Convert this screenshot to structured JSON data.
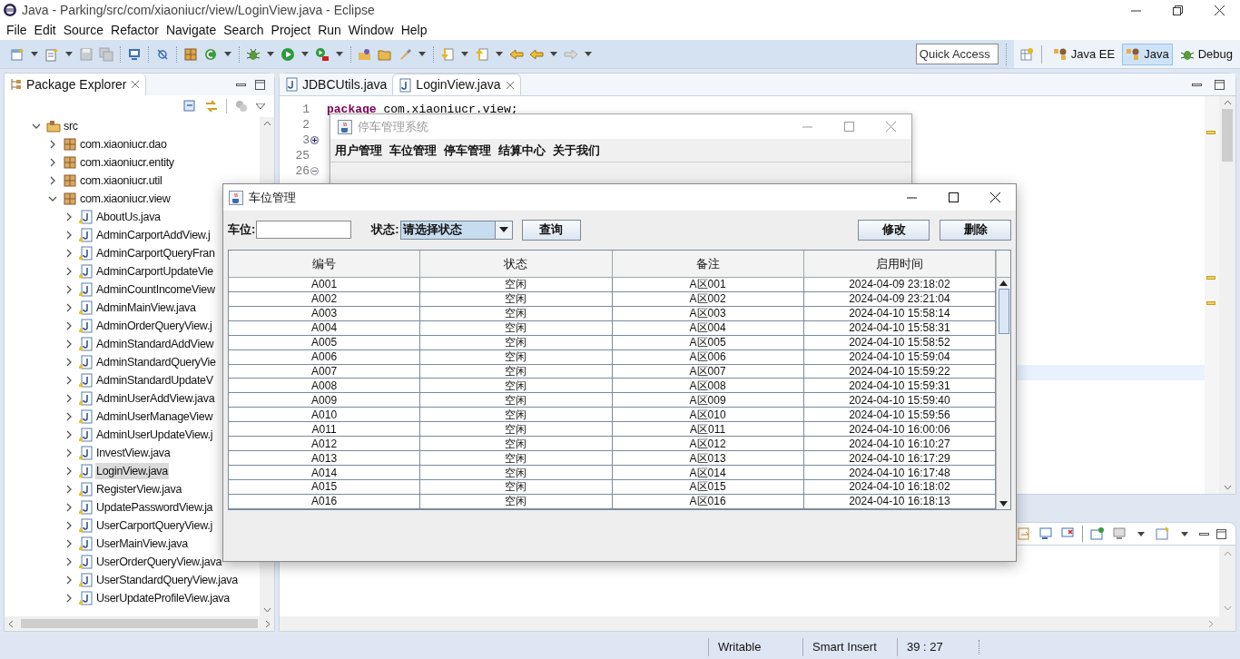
{
  "window": {
    "title": "Java - Parking/src/com/xiaoniucr/view/LoginView.java - Eclipse"
  },
  "menu": [
    "File",
    "Edit",
    "Source",
    "Refactor",
    "Navigate",
    "Search",
    "Project",
    "Run",
    "Window",
    "Help"
  ],
  "toolbar": {
    "quick_access": {
      "placeholder": "Quick Access"
    },
    "perspectives": [
      {
        "label": "Java EE",
        "selected": false
      },
      {
        "label": "Java",
        "selected": true
      },
      {
        "label": "Debug",
        "selected": false
      }
    ]
  },
  "package_explorer": {
    "title": "Package Explorer",
    "tree": [
      {
        "label": "src",
        "kind": "source-folder",
        "expanded": true,
        "selected": false,
        "children": [
          {
            "label": "com.xiaoniucr.dao",
            "kind": "package",
            "expanded": false,
            "selected": false
          },
          {
            "label": "com.xiaoniucr.entity",
            "kind": "package",
            "expanded": false,
            "selected": false
          },
          {
            "label": "com.xiaoniucr.util",
            "kind": "package",
            "expanded": false,
            "selected": false
          },
          {
            "label": "com.xiaoniucr.view",
            "kind": "package",
            "expanded": true,
            "selected": false,
            "children": [
              {
                "label": "AboutUs.java",
                "kind": "file",
                "expanded": false,
                "selected": false
              },
              {
                "label": "AdminCarportAddView.j",
                "kind": "file",
                "expanded": false,
                "selected": false
              },
              {
                "label": "AdminCarportQueryFran",
                "kind": "file",
                "expanded": false,
                "selected": false
              },
              {
                "label": "AdminCarportUpdateVie",
                "kind": "file",
                "expanded": false,
                "selected": false
              },
              {
                "label": "AdminCountIncomeView",
                "kind": "file",
                "expanded": false,
                "selected": false
              },
              {
                "label": "AdminMainView.java",
                "kind": "file",
                "expanded": false,
                "selected": false
              },
              {
                "label": "AdminOrderQueryView.j",
                "kind": "file",
                "expanded": false,
                "selected": false
              },
              {
                "label": "AdminStandardAddView",
                "kind": "file",
                "expanded": false,
                "selected": false
              },
              {
                "label": "AdminStandardQueryVie",
                "kind": "file",
                "expanded": false,
                "selected": false
              },
              {
                "label": "AdminStandardUpdateV",
                "kind": "file",
                "expanded": false,
                "selected": false
              },
              {
                "label": "AdminUserAddView.java",
                "kind": "file",
                "expanded": false,
                "selected": false
              },
              {
                "label": "AdminUserManageView",
                "kind": "file",
                "expanded": false,
                "selected": false
              },
              {
                "label": "AdminUserUpdateView.j",
                "kind": "file",
                "expanded": false,
                "selected": false
              },
              {
                "label": "InvestView.java",
                "kind": "file",
                "expanded": false,
                "selected": false
              },
              {
                "label": "LoginView.java",
                "kind": "file",
                "expanded": false,
                "selected": true
              },
              {
                "label": "RegisterView.java",
                "kind": "file",
                "expanded": false,
                "selected": false
              },
              {
                "label": "UpdatePasswordView.ja",
                "kind": "file",
                "expanded": false,
                "selected": false
              },
              {
                "label": "UserCarportQueryView.j",
                "kind": "file",
                "expanded": false,
                "selected": false
              },
              {
                "label": "UserMainView.java",
                "kind": "file",
                "expanded": false,
                "selected": false
              },
              {
                "label": "UserOrderQueryView.java",
                "kind": "file",
                "expanded": false,
                "selected": false
              },
              {
                "label": "UserStandardQueryView.java",
                "kind": "file",
                "expanded": false,
                "selected": false
              },
              {
                "label": "UserUpdateProfileView.java",
                "kind": "file",
                "expanded": false,
                "selected": false
              }
            ]
          }
        ]
      }
    ]
  },
  "editor": {
    "tabs": [
      {
        "label": "JDBCUtils.java",
        "selected": false
      },
      {
        "label": "LoginView.java",
        "selected": true
      }
    ],
    "lines": [
      {
        "number": "1",
        "tokens": [
          {
            "kind": "keyword",
            "text": "package"
          },
          {
            "kind": "plain",
            "text": " com.xiaoniucr.view;"
          }
        ]
      },
      {
        "number": "2"
      },
      {
        "number": "3",
        "collapsed": true
      },
      {
        "number": "25"
      },
      {
        "number": "26",
        "collapsed": false
      }
    ]
  },
  "main_frame": {
    "title": "停车管理系统",
    "active": false,
    "menus": [
      "用户管理",
      "车位管理",
      "停车管理",
      "结算中心",
      "关于我们"
    ]
  },
  "dialog": {
    "title": "车位管理",
    "active": true,
    "space_label": "车位:",
    "status_label": "状态:",
    "status_select": "请选择状态",
    "query_button": "查询",
    "edit_button": "修改",
    "delete_button": "删除",
    "table": {
      "columns": [
        "编号",
        "状态",
        "备注",
        "启用时间"
      ],
      "rows": [
        [
          "A001",
          "空闲",
          "A区001",
          "2024-04-09 23:18:02"
        ],
        [
          "A002",
          "空闲",
          "A区002",
          "2024-04-09 23:21:04"
        ],
        [
          "A003",
          "空闲",
          "A区003",
          "2024-04-10 15:58:14"
        ],
        [
          "A004",
          "空闲",
          "A区004",
          "2024-04-10 15:58:31"
        ],
        [
          "A005",
          "空闲",
          "A区005",
          "2024-04-10 15:58:52"
        ],
        [
          "A006",
          "空闲",
          "A区006",
          "2024-04-10 15:59:04"
        ],
        [
          "A007",
          "空闲",
          "A区007",
          "2024-04-10 15:59:22"
        ],
        [
          "A008",
          "空闲",
          "A区008",
          "2024-04-10 15:59:31"
        ],
        [
          "A009",
          "空闲",
          "A区009",
          "2024-04-10 15:59:40"
        ],
        [
          "A010",
          "空闲",
          "A区010",
          "2024-04-10 15:59:56"
        ],
        [
          "A011",
          "空闲",
          "A区011",
          "2024-04-10 16:00:06"
        ],
        [
          "A012",
          "空闲",
          "A区012",
          "2024-04-10 16:10:27"
        ],
        [
          "A013",
          "空闲",
          "A区013",
          "2024-04-10 16:17:29"
        ],
        [
          "A014",
          "空闲",
          "A区014",
          "2024-04-10 16:17:48"
        ],
        [
          "A015",
          "空闲",
          "A区015",
          "2024-04-10 16:18:02"
        ],
        [
          "A016",
          "空闲",
          "A区016",
          "2024-04-10 16:18:13"
        ]
      ]
    }
  },
  "status_bar": [
    "Writable",
    "Smart Insert",
    "39 : 27"
  ]
}
